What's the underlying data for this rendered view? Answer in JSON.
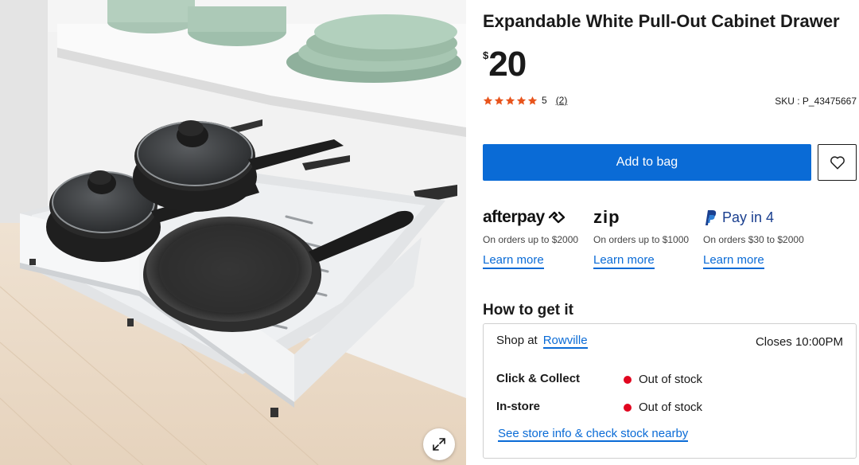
{
  "product": {
    "title": "Expandable White Pull-Out Cabinet Drawer",
    "currency_symbol": "$",
    "price": "20",
    "rating_value": "5",
    "review_count": "(2)",
    "sku": "SKU : P_43475667"
  },
  "actions": {
    "add_to_bag": "Add to bag",
    "wishlist_icon": "heart-icon",
    "zoom_icon": "expand-icon"
  },
  "payments": [
    {
      "logo_text": "afterpay",
      "description": "On orders up to $2000",
      "link": "Learn more"
    },
    {
      "logo_text": "zip",
      "description": "On orders up to $1000",
      "link": "Learn more"
    },
    {
      "logo_text": "Pay in 4",
      "description": "On orders $30 to $2000",
      "link": "Learn more"
    }
  ],
  "fulfilment": {
    "heading": "How to get it",
    "shop_at_label": "Shop at",
    "store_name": "Rowville",
    "closes": "Closes 10:00PM",
    "rows": [
      {
        "label": "Click & Collect",
        "status": "Out of stock"
      },
      {
        "label": "In-store",
        "status": "Out of stock"
      }
    ],
    "store_info_link": "See store info & check stock nearby"
  },
  "colors": {
    "accent_blue": "#0a6bd6",
    "star_orange": "#e8541c",
    "out_of_stock_red": "#e1061f",
    "paypal_blue": "#1a3f8f"
  }
}
